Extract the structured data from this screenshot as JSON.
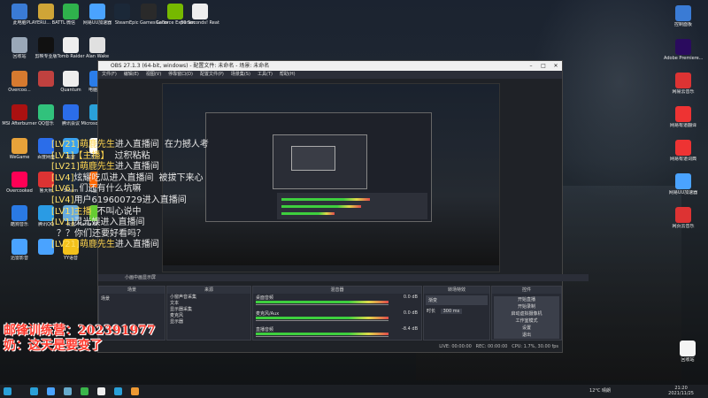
{
  "desktop_icons_left": [
    {
      "label": "此电脑",
      "color": "#3a7bd5"
    },
    {
      "label": "PLAYERU... BATTLEGR...",
      "color": "#cfa537"
    },
    {
      "label": "微信",
      "color": "#2fb24c"
    },
    {
      "label": "网易UU加速器",
      "color": "#4aa3ff"
    },
    {
      "label": "Steam",
      "color": "#1b2838"
    },
    {
      "label": "Epic Games Launcher",
      "color": "#2a2a2a"
    },
    {
      "label": "GeForce Experience",
      "color": "#76b900"
    },
    {
      "label": "60 Seconds! Reatomized",
      "color": "#eeeeee"
    },
    {
      "label": "回收站",
      "color": "#9aa8b8"
    },
    {
      "label": "剪映专业版",
      "color": "#111111"
    },
    {
      "label": "Tomb Raider",
      "color": "#eeeeee"
    },
    {
      "label": "Alan Wake",
      "color": "#e0e0e0"
    },
    {
      "label": "Overcoo...",
      "color": "#d67a2f"
    },
    {
      "label": "",
      "color": "#c0413f"
    },
    {
      "label": "Quantum",
      "color": "#eeeeee"
    },
    {
      "label": "电脑管家",
      "color": "#2b7de9"
    },
    {
      "label": "MSI Afterburner",
      "color": "#a11"
    },
    {
      "label": "QQ音乐",
      "color": "#31c27c"
    },
    {
      "label": "腾讯会议",
      "color": "#2b6de9"
    },
    {
      "label": "Microsoft Edge",
      "color": "#2aa0d8"
    },
    {
      "label": "WeGame",
      "color": "#e7a23a"
    },
    {
      "label": "百度网盘",
      "color": "#2b6de9"
    },
    {
      "label": "迅雷",
      "color": "#3aa2f0"
    },
    {
      "label": "元宇宙",
      "color": "#fff"
    },
    {
      "label": "Overcooked",
      "color": "#f05"
    },
    {
      "label": "鲁大师",
      "color": "#d33"
    },
    {
      "label": "Steam",
      "color": "#1b2838"
    },
    {
      "label": "斗鱼直播",
      "color": "#f60"
    },
    {
      "label": "酷狗音乐",
      "color": "#2a7ae4"
    },
    {
      "label": "腾讯QQ",
      "color": "#2a9be4"
    },
    {
      "label": "云盘",
      "color": "#6ad"
    },
    {
      "label": "Plants vs. Zombies...",
      "color": "#6c3"
    },
    {
      "label": "迅雷影音",
      "color": "#4aa3ff"
    },
    {
      "label": "",
      "color": "#4aa3ff"
    },
    {
      "label": "YY语音",
      "color": "#f3c21b"
    }
  ],
  "desktop_icons_right": [
    {
      "label": "控制面板",
      "color": "#3a7bd5"
    },
    {
      "label": "Adobe Premiere...",
      "color": "#2a0b5e"
    },
    {
      "label": "网易云音乐",
      "color": "#d33"
    },
    {
      "label": "网易有道翻译",
      "color": "#e33"
    },
    {
      "label": "网易有道词典",
      "color": "#e33"
    },
    {
      "label": "网易UU加速器",
      "color": "#4aa3ff"
    },
    {
      "label": "网页云音乐",
      "color": "#d33"
    }
  ],
  "recycle_bin_right": {
    "label": "回收站"
  },
  "obs": {
    "title": "OBS 27.1.3 (64-bit, windows) - 配置文件: 未命名 - 场景: 未命名",
    "menu": [
      "文件(F)",
      "编辑(E)",
      "视图(V)",
      "停靠窗口(D)",
      "配置文件(P)",
      "场景集(S)",
      "工具(T)",
      "帮助(H)"
    ],
    "panels": {
      "scenes": "场景",
      "sources": "来源",
      "mixer": "混音器",
      "transitions": "转场特效",
      "controls": "控件"
    },
    "scene_items": [
      "场景"
    ],
    "source_items": [
      "小窗声音采集",
      "文本",
      "显示器采集",
      "麦克风",
      "显示器"
    ],
    "mixer_tracks": [
      {
        "name": "桌面音频",
        "db": "0.0 dB"
      },
      {
        "name": "麦克风/Aux",
        "db": "0.0 dB"
      },
      {
        "name": "直播音频",
        "db": "-8.4 dB"
      }
    ],
    "transition_type": "渐变",
    "transition_duration_label": "时长",
    "transition_duration": "300 ms",
    "control_buttons": [
      "开始直播",
      "开始录制",
      "启动虚拟摄像机",
      "工作室模式",
      "设置",
      "退出"
    ],
    "status": {
      "live": "LIVE: 00:00:00",
      "rec": "REC: 00:00:00",
      "cpu": "CPU: 1.7%, 30.00 fps"
    },
    "preview_header": "小画中画显示屏"
  },
  "chat": [
    {
      "level": "[LV21]",
      "name": "萌鹿先生",
      "text": "进入直播间",
      "tail": "在力撼人考"
    },
    {
      "level": "[LV1]",
      "name": "【主播】",
      "text": "",
      "tail": "过积粘粘"
    },
    {
      "level": "[LV21]",
      "name": "萌鹿先生",
      "text": "进入直播间",
      "tail": ""
    },
    {
      "level": "[LV4]",
      "name": "",
      "text": "炫耀吃瓜进入直播间",
      "tail": "被拔下来心"
    },
    {
      "level": "[LV6]",
      "name": "",
      "text": "",
      "tail": "们还有什么坑嘛"
    },
    {
      "level": "[LV4]",
      "name": "",
      "text": "用户619600729进入直播间",
      "tail": ""
    },
    {
      "level": "[LV1]",
      "name": "主播",
      "text": "",
      "tail": "不叫心说中"
    },
    {
      "level": "[LV1]",
      "name": "",
      "text": "灵光娱进入直播间",
      "tail": ""
    },
    {
      "level": "",
      "name": "",
      "text": "",
      "tail": "？？你们还要好看吗？"
    },
    {
      "level": "[LV21]",
      "name": "萌鹿先生",
      "text": "进入直播间",
      "tail": ""
    }
  ],
  "danmaku": [
    {
      "text": "邮锋训练营：202391977"
    },
    {
      "text": "奶：这天是要变了"
    }
  ],
  "taskbar": {
    "weather": "12°C 晴朗",
    "time": "21:20",
    "date": "2021/11/25",
    "icons_colors": [
      "#2aa0d8",
      "#4aa3ff",
      "#6ac",
      "#3ab54a",
      "#eeeeee",
      "#2aa0d8",
      "#ee9933"
    ]
  }
}
